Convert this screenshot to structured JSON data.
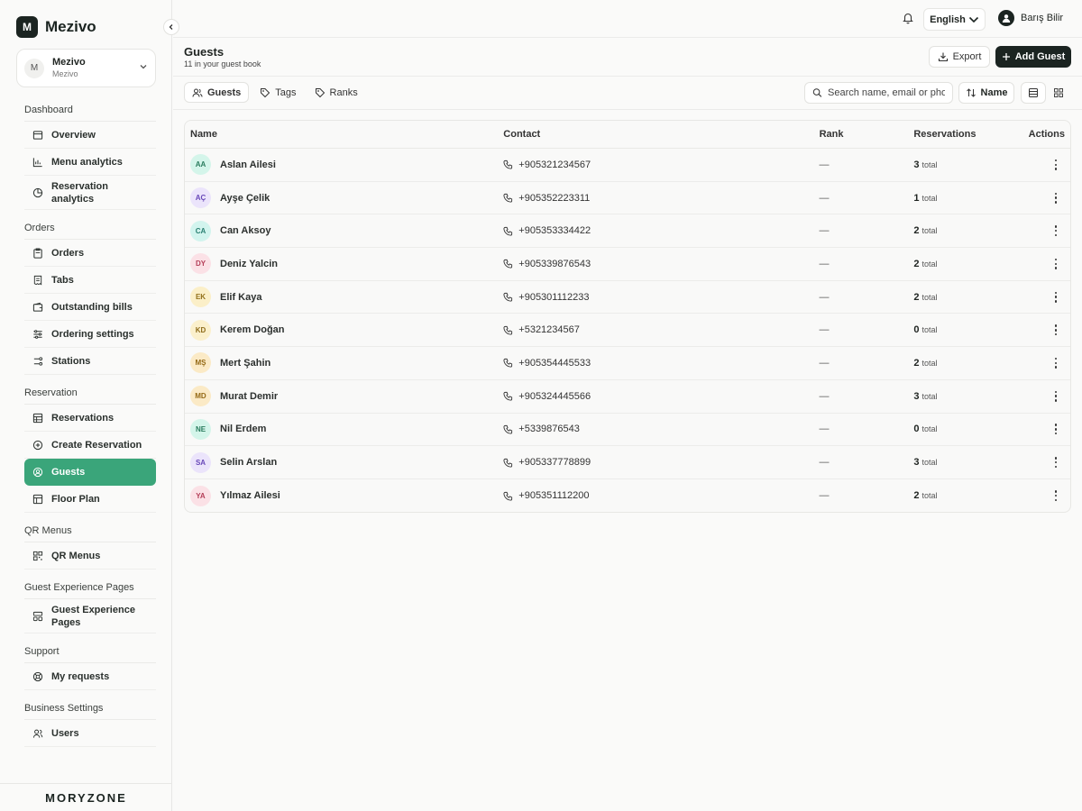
{
  "brand": {
    "logo_letter": "M",
    "name": "Mezivo"
  },
  "workspace": {
    "avatar": "M",
    "name": "Mezivo",
    "subtitle": "Mezivo"
  },
  "sidebar": {
    "sections": [
      {
        "label": "Dashboard",
        "items": [
          {
            "label": "Overview",
            "icon": "overview-icon"
          },
          {
            "label": "Menu analytics",
            "icon": "bar-chart-icon"
          },
          {
            "label": "Reservation analytics",
            "icon": "pie-chart-icon"
          }
        ]
      },
      {
        "label": "Orders",
        "items": [
          {
            "label": "Orders",
            "icon": "clipboard-icon"
          },
          {
            "label": "Tabs",
            "icon": "receipt-icon"
          },
          {
            "label": "Outstanding bills",
            "icon": "wallet-icon"
          },
          {
            "label": "Ordering settings",
            "icon": "sliders-icon"
          },
          {
            "label": "Stations",
            "icon": "stations-icon"
          }
        ]
      },
      {
        "label": "Reservation",
        "items": [
          {
            "label": "Reservations",
            "icon": "table-icon"
          },
          {
            "label": "Create Reservation",
            "icon": "plus-circle-icon"
          },
          {
            "label": "Guests",
            "icon": "user-circle-icon",
            "active": true
          },
          {
            "label": "Floor Plan",
            "icon": "floor-plan-icon"
          }
        ]
      },
      {
        "label": "QR Menus",
        "items": [
          {
            "label": "QR Menus",
            "icon": "qr-code-icon"
          }
        ]
      },
      {
        "label": "Guest Experience Pages",
        "items": [
          {
            "label": "Guest Experience Pages",
            "icon": "layout-icon"
          }
        ]
      },
      {
        "label": "Support",
        "items": [
          {
            "label": "My requests",
            "icon": "lifebuoy-icon"
          }
        ]
      },
      {
        "label": "Business Settings",
        "items": [
          {
            "label": "Users",
            "icon": "users-icon"
          }
        ]
      }
    ],
    "footer_logo": "MORYZONE"
  },
  "topbar": {
    "language": "English",
    "user_name": "Barış Bilir"
  },
  "page": {
    "title": "Guests",
    "subtitle": "11 in your guest book",
    "export_label": "Export",
    "add_label": "Add Guest"
  },
  "tabs": [
    "Guests",
    "Tags",
    "Ranks"
  ],
  "search": {
    "placeholder": "Search name, email or phone"
  },
  "sort": {
    "label": "Name"
  },
  "table": {
    "headers": {
      "name": "Name",
      "contact": "Contact",
      "rank": "Rank",
      "reservations": "Reservations",
      "actions": "Actions"
    },
    "total_label": "total",
    "rows": [
      {
        "initials": "AA",
        "name": "Aslan Ailesi",
        "phone": "+905321234567",
        "rank": "—",
        "reservations": "3",
        "color": "#d4f5ea",
        "text": "#2a7c5e"
      },
      {
        "initials": "AÇ",
        "name": "Ayşe Çelik",
        "phone": "+905352223311",
        "rank": "—",
        "reservations": "1",
        "color": "#ebe4fb",
        "text": "#6848b8"
      },
      {
        "initials": "CA",
        "name": "Can Aksoy",
        "phone": "+905353334422",
        "rank": "—",
        "reservations": "2",
        "color": "#d2f4ee",
        "text": "#2a7f72"
      },
      {
        "initials": "DY",
        "name": "Deniz Yalcin",
        "phone": "+905339876543",
        "rank": "—",
        "reservations": "2",
        "color": "#fbe1e6",
        "text": "#b43e58"
      },
      {
        "initials": "EK",
        "name": "Elif Kaya",
        "phone": "+905301112233",
        "rank": "—",
        "reservations": "2",
        "color": "#fbefc8",
        "text": "#92701a"
      },
      {
        "initials": "KD",
        "name": "Kerem Doğan",
        "phone": "+5321234567",
        "rank": "—",
        "reservations": "0",
        "color": "#fbf0cc",
        "text": "#8e6c1a"
      },
      {
        "initials": "MŞ",
        "name": "Mert Şahin",
        "phone": "+905354445533",
        "rank": "—",
        "reservations": "2",
        "color": "#fbeac6",
        "text": "#956a16"
      },
      {
        "initials": "MD",
        "name": "Murat Demir",
        "phone": "+905324445566",
        "rank": "—",
        "reservations": "3",
        "color": "#fbeac6",
        "text": "#956a16"
      },
      {
        "initials": "NE",
        "name": "Nil Erdem",
        "phone": "+5339876543",
        "rank": "—",
        "reservations": "0",
        "color": "#d4f5ea",
        "text": "#2a7c5e"
      },
      {
        "initials": "SA",
        "name": "Selin Arslan",
        "phone": "+905337778899",
        "rank": "—",
        "reservations": "3",
        "color": "#ebe4fb",
        "text": "#6848b8"
      },
      {
        "initials": "YA",
        "name": "Yılmaz Ailesi",
        "phone": "+905351112200",
        "rank": "—",
        "reservations": "2",
        "color": "#fbe1e6",
        "text": "#b43e58"
      }
    ]
  }
}
